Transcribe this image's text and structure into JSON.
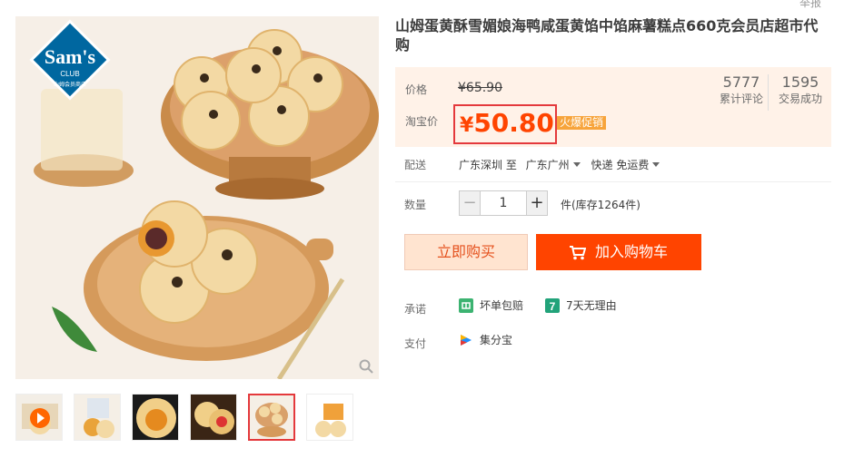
{
  "top_link": "举报",
  "logo": {
    "brand": "Sam's",
    "sub": "CLUB",
    "cn": "山姆会员商店"
  },
  "title": "山姆蛋黄酥雪媚娘海鸭咸蛋黄馅中馅麻薯糕点660克会员店超市代购",
  "price": {
    "label": "价格",
    "original": "¥65.90"
  },
  "promo": {
    "label": "淘宝价",
    "currency": "¥",
    "value": "50.80",
    "tag": "火爆促销"
  },
  "stats": [
    {
      "num": "5777",
      "label": "累计评论"
    },
    {
      "num": "1595",
      "label": "交易成功"
    }
  ],
  "delivery": {
    "label": "配送",
    "from": "广东深圳 至",
    "to": "广东广州",
    "shipping": "快递 免运费"
  },
  "quantity": {
    "label": "数量",
    "minus": "−",
    "value": "1",
    "plus": "+",
    "stock": "件(库存1264件)"
  },
  "buttons": {
    "buy": "立即购买",
    "cart": "加入购物车"
  },
  "promise": {
    "label": "承诺",
    "items": [
      "坏单包赔",
      "7天无理由"
    ]
  },
  "payment": {
    "label": "支付",
    "method": "集分宝"
  },
  "colors": {
    "accent": "#ff4400",
    "price": "#ff4400",
    "tag": "#f7a43b",
    "highlight_border": "#e4393c"
  }
}
